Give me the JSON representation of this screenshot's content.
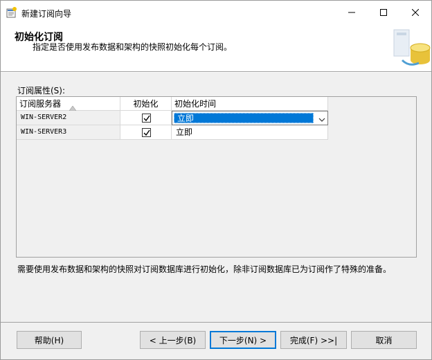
{
  "window": {
    "title": "新建订阅向导"
  },
  "header": {
    "title": "初始化订阅",
    "subtitle": "指定是否使用发布数据和架构的快照初始化每个订阅。"
  },
  "grid": {
    "label": "订阅属性(S):",
    "columns": {
      "server": "订阅服务器",
      "init": "初始化",
      "time": "初始化时间"
    },
    "rows": [
      {
        "server": "WIN-SERVER2",
        "init_checked": true,
        "time": "立即"
      },
      {
        "server": "WIN-SERVER3",
        "init_checked": true,
        "time": "立即"
      }
    ]
  },
  "note": "需要使用发布数据和架构的快照对订阅数据库进行初始化，除非订阅数据库已为订阅作了特殊的准备。",
  "buttons": {
    "help": "帮助(H)",
    "back": "< 上一步(B)",
    "next": "下一步(N) >",
    "finish": "完成(F) >>|",
    "cancel": "取消"
  },
  "colors": {
    "accent": "#0078d7",
    "background": "#f0f0f0"
  },
  "icons": [
    "wizard-app-icon",
    "minimize-icon",
    "maximize-icon",
    "close-icon",
    "sort-ascending-icon",
    "checkmark-icon",
    "chevron-down-icon",
    "database-graphic"
  ]
}
